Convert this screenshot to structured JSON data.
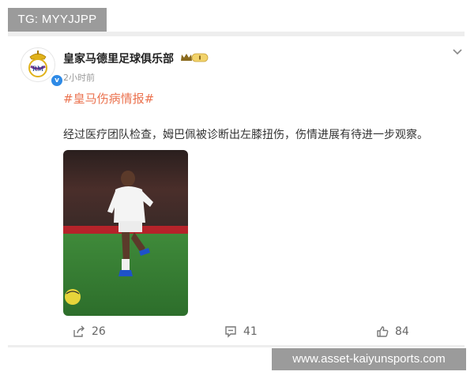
{
  "watermark_top": "TG: MYYJJPP",
  "watermark_bottom": "www.asset-kaiyunsports.com",
  "post": {
    "account_name": "皇家马德里足球俱乐部",
    "time": "2小时前",
    "hashtag": "#皇马伤病情报#",
    "text": "经过医疗团队检查，姆巴佩被诊断出左膝扭伤，伤情进展有待进一步观察。",
    "badge_icon": "vip-crown-badge-icon",
    "more_icon": "chevron-down-icon"
  },
  "actions": {
    "repost_count": "26",
    "comment_count": "41",
    "like_count": "84"
  },
  "colors": {
    "hashtag": "#eb7350",
    "verified": "#2e8ae6",
    "watermark_bg": "#9b9b9b"
  }
}
